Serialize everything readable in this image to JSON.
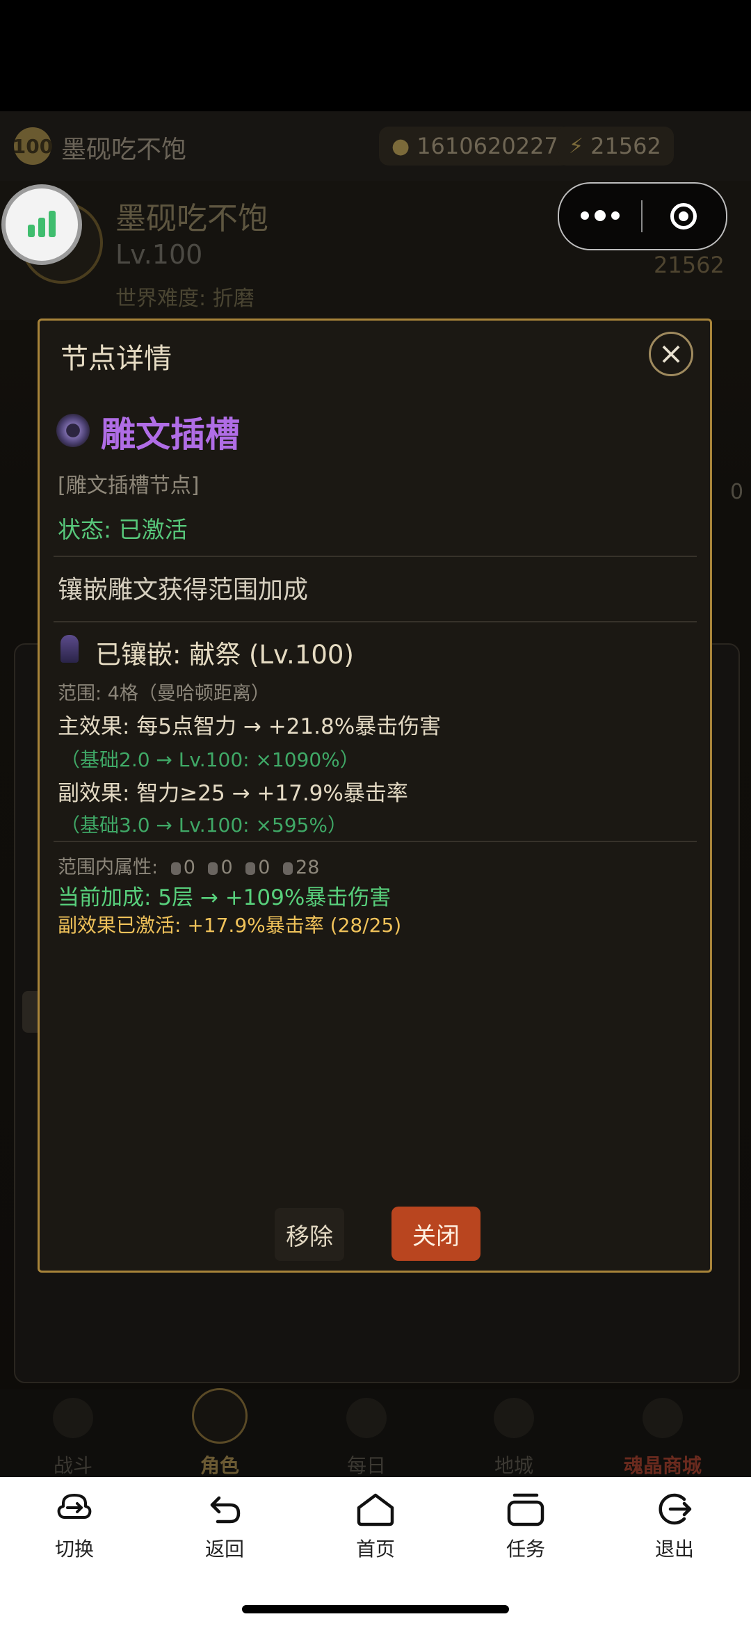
{
  "game_header": {
    "level_badge": "100",
    "player_name": "墨砚吃不饱",
    "gold": "1610620227",
    "energy": "21562"
  },
  "profile": {
    "name": "墨砚吃不饱",
    "level": "Lv.100",
    "difficulty": "世界难度: 折磨",
    "points": "21562",
    "side_value": "0"
  },
  "modal": {
    "title": "节点详情",
    "node_name": "雕文插槽",
    "node_type": "[雕文插槽节点]",
    "status": "状态: 已激活",
    "description": "镶嵌雕文获得范围加成",
    "socketed": "已镶嵌: 献祭 (Lv.100)",
    "range": "范围: 4格（曼哈顿距离）",
    "main_effect": "主效果: 每5点智力 → +21.8%暴击伤害",
    "main_scaling": "（基础2.0 → Lv.100: ×1090%）",
    "sub_effect": "副效果: 智力≥25 → +17.9%暴击率",
    "sub_scaling": "（基础3.0 → Lv.100: ×595%）",
    "attr_label": "范围内属性:",
    "attr_values": [
      "0",
      "0",
      "0",
      "28"
    ],
    "current_bonus": "当前加成: 5层 → +109%暴击伤害",
    "sub_active": "副效果已激活: +17.9%暴击率 (28/25)",
    "remove_button": "移除",
    "close_button": "关闭"
  },
  "game_nav": [
    "战斗",
    "角色",
    "每日",
    "地城",
    "魂晶商城"
  ],
  "system_toolbar": [
    "切换",
    "返回",
    "首页",
    "任务",
    "退出"
  ],
  "colors": {
    "accent_gold": "#a8843a",
    "node_purple": "#b06de6",
    "status_green": "#57c77a",
    "close_button_bg": "#b9451f",
    "highlight_gold": "#f0c25a"
  }
}
